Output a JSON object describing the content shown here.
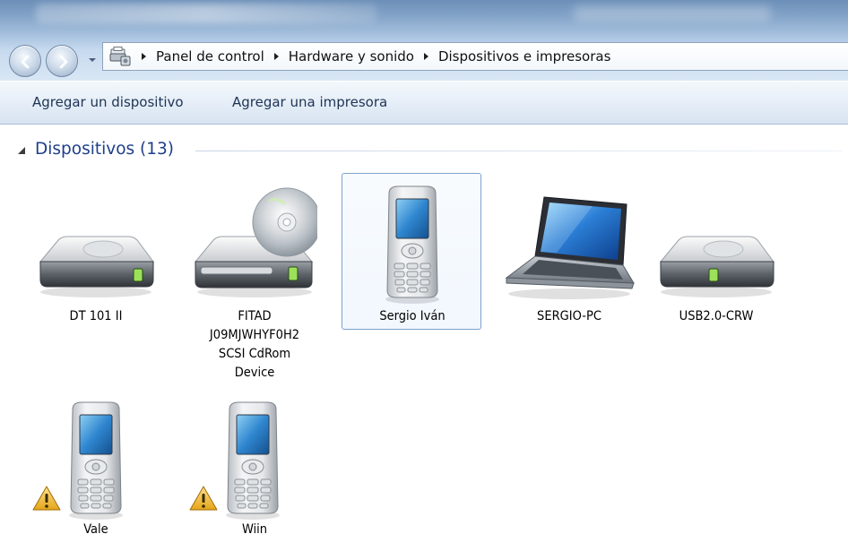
{
  "window": {
    "breadcrumb": [
      "Panel de control",
      "Hardware y sonido",
      "Dispositivos e impresoras"
    ],
    "address_icon": "devices-printers-icon"
  },
  "toolbar": {
    "add_device_label": "Agregar un dispositivo",
    "add_printer_label": "Agregar una impresora"
  },
  "group": {
    "title": "Dispositivos (13)"
  },
  "devices": [
    {
      "name": "DT 101 II",
      "icon": "drive-icon",
      "warning": false,
      "selected": false
    },
    {
      "name_lines": [
        "FITAD",
        "J09MJWHYF0H2",
        "SCSI CdRom",
        "Device"
      ],
      "icon": "cdrom-drive-icon",
      "warning": false,
      "selected": false
    },
    {
      "name": "Sergio Iván",
      "icon": "mobile-phone-icon",
      "warning": false,
      "selected": true
    },
    {
      "name": "SERGIO-PC",
      "icon": "laptop-icon",
      "warning": false,
      "selected": false
    },
    {
      "name": "USB2.0-CRW",
      "icon": "drive-icon",
      "warning": false,
      "selected": false
    },
    {
      "name": "Vale",
      "icon": "mobile-phone-icon",
      "warning": true,
      "selected": false
    },
    {
      "name": "Wiin",
      "icon": "mobile-phone-icon",
      "warning": true,
      "selected": false
    }
  ],
  "colors": {
    "accent": "#1e3f8a",
    "selection_border": "#7da2ce",
    "warning": "#f2c230"
  }
}
